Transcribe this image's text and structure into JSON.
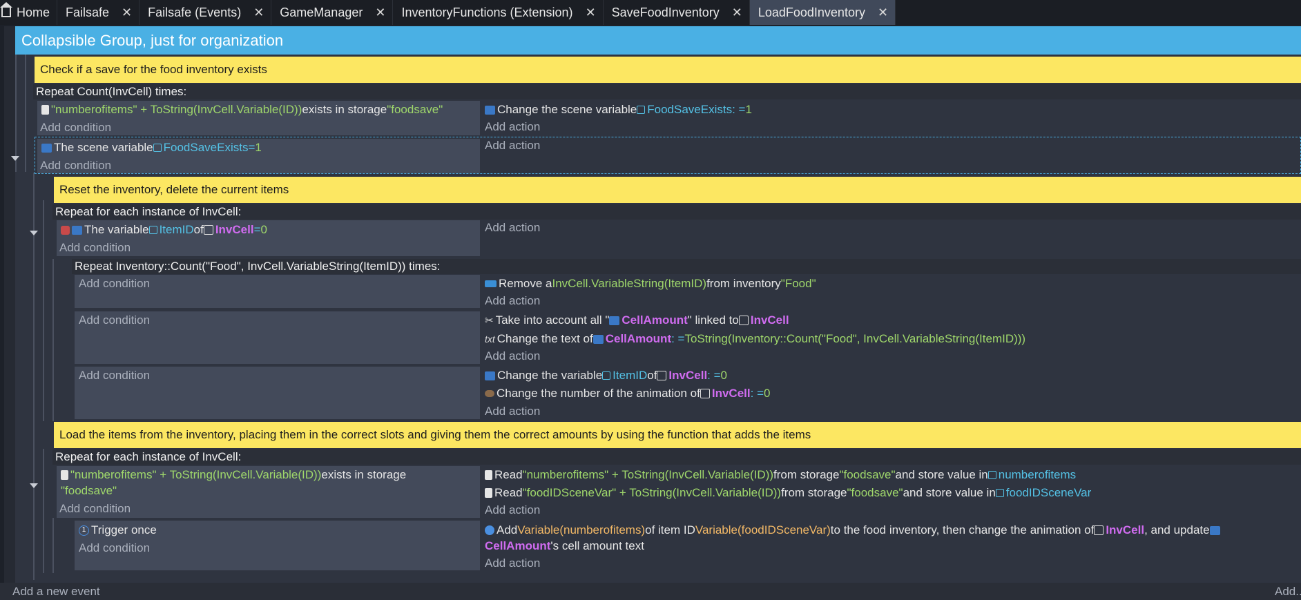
{
  "tabs": [
    {
      "label": "Home"
    },
    {
      "label": "Failsafe"
    },
    {
      "label": "Failsafe (Events)"
    },
    {
      "label": "GameManager"
    },
    {
      "label": "InventoryFunctions (Extension)"
    },
    {
      "label": "SaveFoodInventory"
    },
    {
      "label": "LoadFoodInventory"
    }
  ],
  "close_glyph": "✕",
  "group_title": "Collapsible Group, just for organization",
  "comments": {
    "c1": "Check if a save for the food inventory exists",
    "c2": "Reset the inventory, delete the current items",
    "c3": "Load the items from the inventory, placing them in the correct slots and giving them the correct amounts by using the function that adds the items"
  },
  "add_condition": "Add condition",
  "add_action": "Add action",
  "e1": {
    "repeat": "Repeat Count(InvCell) times:",
    "cond": {
      "a": "\"numberofitems\" + ToString(InvCell.Variable(ID))",
      "b": " exists in storage ",
      "c": "\"foodsave\""
    },
    "act": {
      "a": "Change the scene variable ",
      "b": "FoodSaveExists",
      "c": ": = ",
      "d": "1"
    }
  },
  "e2": {
    "cond": {
      "a": "The scene variable ",
      "b": "FoodSaveExists",
      "c": " = ",
      "d": "1"
    }
  },
  "e3": {
    "repeat": "Repeat for each instance of InvCell:",
    "cond": {
      "a": "The variable ",
      "b": "ItemID",
      "c": " of ",
      "d": "InvCell",
      "e": " = ",
      "f": "0"
    }
  },
  "e4": {
    "repeat": "Repeat Inventory::Count(\"Food\", InvCell.VariableString(ItemID)) times:",
    "act": {
      "a": "Remove a ",
      "b": "InvCell.VariableString(ItemID)",
      "c": " from inventory ",
      "d": "\"Food\""
    }
  },
  "e5": {
    "act1": {
      "a": "Take into account all \"",
      "b": "CellAmount",
      "c": "\" linked to ",
      "d": "InvCell"
    },
    "act2": {
      "a": "Change the text of ",
      "b": "CellAmount",
      "c": ": = ",
      "d": "ToString(Inventory::Count(\"Food\", InvCell.VariableString(ItemID)))"
    }
  },
  "e6": {
    "act1": {
      "a": "Change the variable ",
      "b": "ItemID",
      "c": " of ",
      "d": "InvCell",
      "e": ": = ",
      "f": "0"
    },
    "act2": {
      "a": "Change the number of the animation of ",
      "b": "InvCell",
      "c": ": = ",
      "d": "0"
    }
  },
  "e7": {
    "repeat": "Repeat for each instance of InvCell:",
    "cond": {
      "a": "\"numberofitems\" + ToString(InvCell.Variable(ID))",
      "b": " exists in storage",
      "c": "\"foodsave\""
    },
    "act1": {
      "a": "Read ",
      "b": "\"numberofitems\" + ToString(InvCell.Variable(ID))",
      "c": " from storage ",
      "d": "\"foodsave\"",
      "e": " and store value in ",
      "f": "numberofitems"
    },
    "act2": {
      "a": "Read ",
      "b": "\"foodIDSceneVar\" + ToString(InvCell.Variable(ID))",
      "c": " from storage ",
      "d": "\"foodsave\"",
      "e": " and store value in ",
      "f": "foodIDSceneVar"
    }
  },
  "e8": {
    "cond": "Trigger once",
    "act": {
      "a": "Add ",
      "b": "Variable(numberofitems)",
      "c": " of item ID ",
      "d": "Variable(foodIDSceneVar)",
      "e": " to the food inventory, then change the animation of ",
      "f": "InvCell",
      "g": ", and update ",
      "h": "CellAmount",
      "i": "'s cell amount text"
    }
  },
  "footer": {
    "add_event": "Add a new event",
    "add_right": "Add..."
  }
}
